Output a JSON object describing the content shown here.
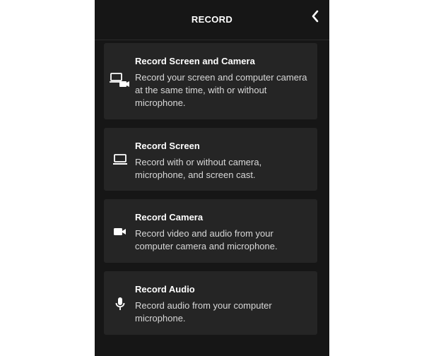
{
  "header": {
    "title": "RECORD",
    "back_icon": "chevron-left-icon"
  },
  "options": [
    {
      "title": "Record Screen and Camera",
      "description": "Record your screen and computer camera at the same time, with or without microphone.",
      "icon": "screen-camera-icon"
    },
    {
      "title": "Record Screen",
      "description": "Record with or without camera, microphone, and screen cast.",
      "icon": "laptop-icon"
    },
    {
      "title": "Record Camera",
      "description": "Record video and audio from your computer camera and microphone.",
      "icon": "video-camera-icon"
    },
    {
      "title": "Record Audio",
      "description": "Record audio from your computer microphone.",
      "icon": "microphone-icon"
    }
  ],
  "colors": {
    "panel_background": "#161616",
    "card_background": "#252525",
    "text_primary": "#ffffff",
    "text_secondary": "#d8d8d8"
  }
}
